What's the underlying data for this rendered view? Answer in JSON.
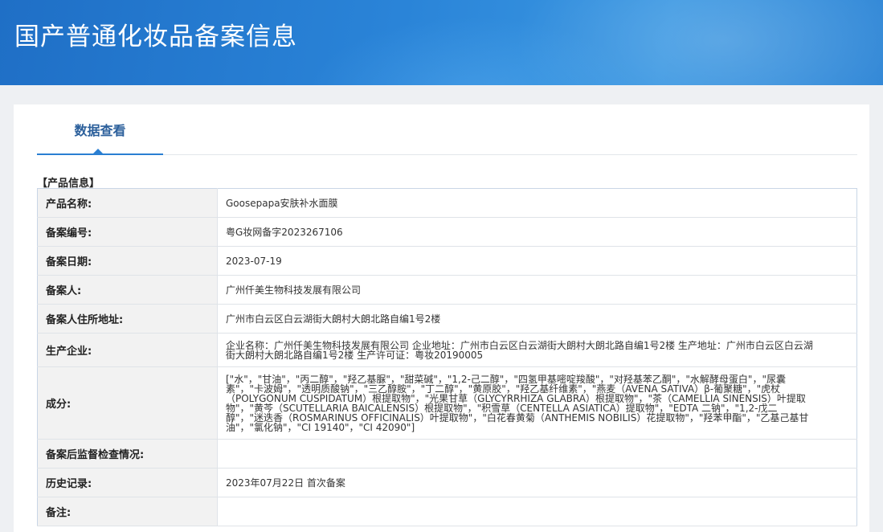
{
  "header": {
    "title": "国产普通化妆品备案信息"
  },
  "tabs": [
    {
      "label": "数据查看"
    }
  ],
  "section": {
    "title": "【产品信息】"
  },
  "rows": [
    {
      "label": "产品名称:",
      "value": "Goosepapa安肤补水面膜"
    },
    {
      "label": "备案编号:",
      "value": "粤G妆网备字2023267106"
    },
    {
      "label": "备案日期:",
      "value": "2023-07-19"
    },
    {
      "label": "备案人:",
      "value": "广州仟美生物科技发展有限公司"
    },
    {
      "label": "备案人住所地址:",
      "value": "广州市白云区白云湖街大朗村大朗北路自编1号2楼"
    },
    {
      "label": "生产企业:",
      "value": "企业名称：广州仟美生物科技发展有限公司 企业地址：广州市白云区白云湖街大朗村大朗北路自编1号2楼 生产地址：广州市白云区白云湖街大朗村大朗北路自编1号2楼 生产许可证：粤妆20190005"
    },
    {
      "label": "成分:",
      "value": "[\"水\"，\"甘油\"，\"丙二醇\"，\"羟乙基脲\"，\"甜菜碱\"，\"1,2-己二醇\"，\"四氢甲基嘧啶羧酸\"，\"对羟基苯乙酮\"，\"水解酵母蛋白\"，\"尿囊素\"，\"卡波姆\"，\"透明质酸钠\"，\"三乙醇胺\"，\"丁二醇\"，\"黄原胶\"，\"羟乙基纤维素\"，\"燕麦（AVENA SATIVA）β-葡聚糖\"，\"虎杖（POLYGONUM CUSPIDATUM）根提取物\"，\"光果甘草（GLYCYRRHIZA GLABRA）根提取物\"，\"茶（CAMELLIA SINENSIS）叶提取物\"，\"黄芩（SCUTELLARIA BAICALENSIS）根提取物\"，\"积雪草（CENTELLA ASIATICA）提取物\"，\"EDTA 二钠\"，\"1,2-戊二醇\"，\"迷迭香（ROSMARINUS OFFICINALIS）叶提取物\"，\"白花春黄菊（ANTHEMIS NOBILIS）花提取物\"，\"羟苯甲酯\"，\"乙基己基甘油\"，\"氯化钠\"，\"CI 19140\"，\"CI 42090\"]"
    },
    {
      "label": "备案后监督检查情况:",
      "value": ""
    },
    {
      "label": "历史记录:",
      "value": "2023年07月22日 首次备案"
    },
    {
      "label": "备注:",
      "value": ""
    }
  ],
  "colors": {
    "banner": "#2a84d8",
    "accent": "#2a7fd2",
    "tab_text": "#2b5f9b"
  }
}
